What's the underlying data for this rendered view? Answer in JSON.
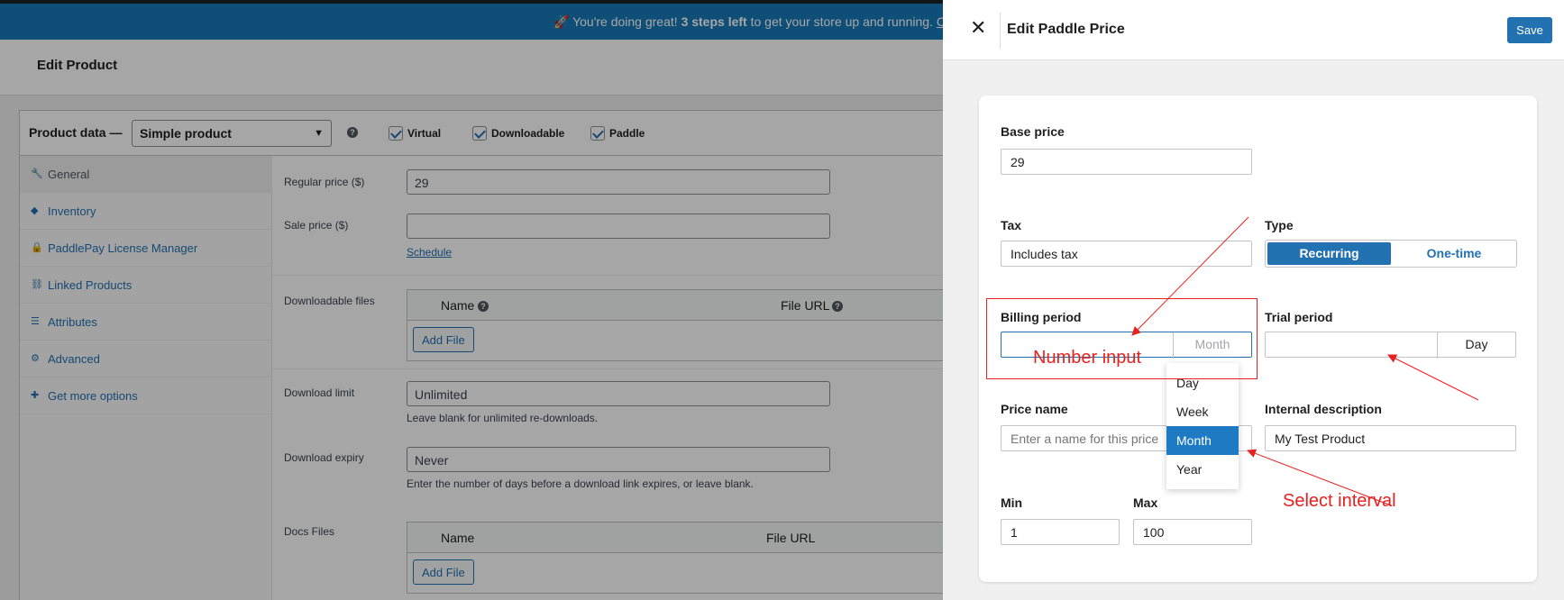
{
  "notice": {
    "emoji": "🚀",
    "prefix": "You're doing great! ",
    "bold": "3 steps left",
    "suffix": " to get your store up and running. ",
    "link": "Con"
  },
  "page_title": "Edit Product",
  "product_data": {
    "label": "Product data —",
    "type_select": "Simple product",
    "checkboxes": [
      {
        "label": "Virtual",
        "checked": true
      },
      {
        "label": "Downloadable",
        "checked": true
      },
      {
        "label": "Paddle",
        "checked": true
      }
    ]
  },
  "tabs": [
    {
      "label": "General",
      "icon": "wrench-icon",
      "glyph": "🔧",
      "active": true
    },
    {
      "label": "Inventory",
      "icon": "tag-icon",
      "glyph": "◆",
      "active": false
    },
    {
      "label": "PaddlePay License Manager",
      "icon": "lock-icon",
      "glyph": "🔒",
      "active": false
    },
    {
      "label": "Linked Products",
      "icon": "link-icon",
      "glyph": "⛓",
      "active": false
    },
    {
      "label": "Attributes",
      "icon": "list-icon",
      "glyph": "☰",
      "active": false
    },
    {
      "label": "Advanced",
      "icon": "gear-icon",
      "glyph": "⚙",
      "active": false
    },
    {
      "label": "Get more options",
      "icon": "plugin-icon",
      "glyph": "✚",
      "active": false
    }
  ],
  "general": {
    "regular_price_label": "Regular price ($)",
    "regular_price_value": "29",
    "sale_price_label": "Sale price ($)",
    "sale_price_value": "",
    "schedule_link": "Schedule",
    "downloadable_files_label": "Downloadable files",
    "files_col_name": "Name",
    "files_col_url": "File URL",
    "add_file": "Add File",
    "download_limit_label": "Download limit",
    "download_limit_value": "Unlimited",
    "download_limit_note": "Leave blank for unlimited re-downloads.",
    "download_expiry_label": "Download expiry",
    "download_expiry_value": "Never",
    "download_expiry_note": "Enter the number of days before a download link expires, or leave blank.",
    "docs_files_label": "Docs Files",
    "docs_col_name": "Name",
    "docs_col_url": "File URL",
    "docs_add_file": "Add File"
  },
  "drawer": {
    "title": "Edit Paddle Price",
    "save": "Save",
    "base_price_label": "Base price",
    "base_price_value": "29",
    "tax_label": "Tax",
    "tax_value": "Includes tax",
    "type_label": "Type",
    "type_options": [
      "Recurring",
      "One-time"
    ],
    "type_selected": "Recurring",
    "billing_label": "Billing period",
    "billing_number": "",
    "billing_unit": "Month",
    "trial_label": "Trial period",
    "trial_number": "",
    "trial_unit": "Day",
    "price_name_label": "Price name",
    "price_name_placeholder": "Enter a name for this price",
    "internal_desc_label": "Internal description",
    "internal_desc_value": "My Test Product",
    "min_label": "Min",
    "min_value": "1",
    "max_label": "Max",
    "max_value": "100",
    "interval_options": [
      "Day",
      "Week",
      "Month",
      "Year"
    ],
    "interval_selected": "Month"
  },
  "annotations": {
    "number_input": "Number input",
    "select_interval": "Select interval",
    "color": "#e8201f"
  }
}
